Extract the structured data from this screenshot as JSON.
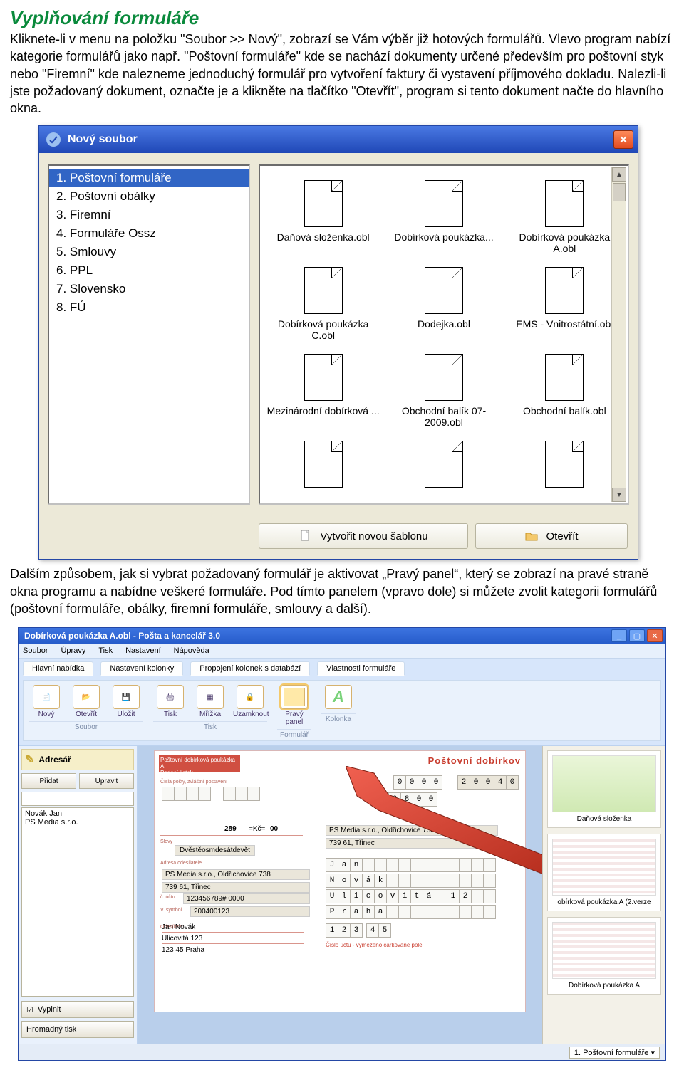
{
  "heading": "Vyplňování formuláře",
  "intro1": "Kliknete-li v menu na položku \"Soubor >> Nový\", zobrazí se Vám výběr již hotových formulářů. Vlevo program nabízí kategorie formulářů jako např. \"Poštovní formuláře\" kde se nachází dokumenty určené především pro poštovní styk nebo \"Firemní\" kde nalezneme jednoduchý formulář pro vytvoření faktury či vystavení příjmového dokladu. Nalezli-li jste požadovaný dokument, označte je a klikněte na tlačítko \"Otevřít\", program si tento dokument načte do hlavního okna.",
  "intro2": "Dalším způsobem, jak si vybrat požadovaný formulář je aktivovat „Pravý panel“, který se zobrazí na pravé straně okna programu a nabídne veškeré formuláře. Pod tímto panelem (vpravo dole) si můžete zvolit kategorii formulářů (poštovní formuláře, obálky, firemní formuláře, smlouvy a další).",
  "dialog1": {
    "title": "Nový soubor",
    "categories": [
      "1. Poštovní formuláře",
      "2. Poštovní obálky",
      "3. Firemní",
      "4. Formuláře Ossz",
      "5. Smlouvy",
      "6. PPL",
      "7. Slovensko",
      "8. FÚ"
    ],
    "files": [
      "Daňová složenka.obl",
      "Dobírková poukázka...",
      "Dobírková poukázka A.obl",
      "Dobírková poukázka C.obl",
      "Dodejka.obl",
      "EMS - Vnitrostátní.obl",
      "Mezinárodní dobírková ...",
      "Obchodní balík 07-2009.obl",
      "Obchodní balík.obl"
    ],
    "btn_new_template": "Vytvořit novou šablonu",
    "btn_open": "Otevřít"
  },
  "app": {
    "title": "Dobírková poukázka A.obl - Pošta a kancelář 3.0",
    "menu": [
      "Soubor",
      "Úpravy",
      "Tisk",
      "Nastavení",
      "Nápověda"
    ],
    "ribbon_tabs": [
      "Hlavní nabídka",
      "Nastavení kolonky",
      "Propojení kolonek s databází",
      "Vlastnosti formuláře"
    ],
    "ribbon_items": {
      "soubor": [
        "Nový",
        "Otevřít",
        "Uložit"
      ],
      "tisk": [
        "Tisk",
        "Mřížka",
        "Uzamknout"
      ],
      "formular": [
        "Pravý panel"
      ],
      "kolonka": [
        ""
      ]
    },
    "ribbon_groups": [
      "Soubor",
      "Tisk",
      "Formulář",
      "Kolonka"
    ],
    "left": {
      "adresar": "Adresář",
      "btn_add": "Přidat",
      "btn_del": "Upravit",
      "names": [
        "Novák Jan",
        "PS Media s.r.o."
      ],
      "fill_btn": "Vyplnit",
      "bulk_btn": "Hromadný tisk"
    },
    "form": {
      "top_title": "Poštovní dobírkov",
      "grid_rows": {
        "r1": [
          "0",
          "0",
          "0",
          "0",
          "",
          "",
          "2",
          "0",
          "0",
          "4",
          "0"
        ],
        "r2": [
          "0",
          "8",
          "0",
          "0"
        ]
      },
      "kc_label": "=Kč=",
      "amount_left": "289",
      "amount_right": "00",
      "words": "Dvěstěosmdesátdevět",
      "sender1": "PS Media s.r.o., Oldřichovice 738",
      "sender2": "739 61, Třinec",
      "field1": "PS Media s.r.o., Oldřichovice 738",
      "field2": "739 61, Třinec",
      "field3": "123456789# 0000",
      "field4": "200400123",
      "nameline": "Jan   Novák",
      "street": "Ulicovitá 123",
      "city": "123 45   Praha",
      "rname": [
        "J",
        "a",
        "n"
      ],
      "rname2": [
        "N",
        "o",
        "v",
        "á",
        "k"
      ],
      "rstreet": [
        "U",
        "l",
        "i",
        "c",
        "o",
        "v",
        "i",
        "t",
        "á",
        "",
        "1"
      ],
      "rcity": [
        "P",
        "r",
        "a",
        "h",
        "a"
      ],
      "rzip": [
        "1",
        "2",
        "3",
        "",
        "4",
        "5"
      ],
      "footnote": "Číslo účtu - vymezeno čárkované pole"
    },
    "right": {
      "cards": [
        "Daňová složenka",
        "obírková poukázka A (2.verze",
        "Dobírková poukázka A"
      ]
    },
    "status_dropdown": "1. Poštovní formuláře"
  }
}
